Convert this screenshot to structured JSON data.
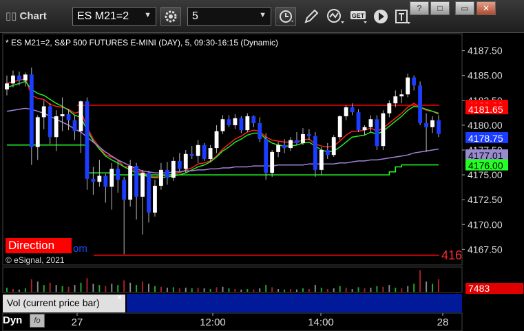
{
  "toolbar": {
    "title": "Chart",
    "symbol_value": "ES M21=2",
    "interval_value": "5",
    "get_label": "GET"
  },
  "window_buttons": [
    "?",
    "□",
    "▭",
    "✕"
  ],
  "chart": {
    "info": "* ES M21=2, S&P 500 FUTURES E-MINI (DAY), 5, 09:30-16:15 (Dynamic)",
    "copyright": "© eSignal, 2021",
    "direction_label": "Direction",
    "direction_tail": "om",
    "right_cut_label": "416",
    "y_ticks": [
      "4187.50",
      "4185.00",
      "4182.50",
      "4180.00",
      "4177.50",
      "4175.00",
      "4172.50",
      "4170.00",
      "4167.50"
    ],
    "x_ticks": [
      "27",
      "12:00",
      "14:00",
      "28"
    ],
    "badges": [
      {
        "text": "4182.00",
        "color": "#ff0000"
      },
      {
        "text": "4181.65",
        "color": "#ff0000"
      },
      {
        "text": "4178.75",
        "color": "#1a3dff"
      },
      {
        "text": "4177.01",
        "color": "#9a8ad0"
      },
      {
        "text": "4176.00",
        "color": "#22ff22"
      }
    ],
    "volume_badge": "7483",
    "volume_label": "Vol (current price bar)",
    "close_glyph": "×",
    "footer_label": "Dyn",
    "footer_icon": "fo"
  },
  "chart_data": {
    "type": "candlestick",
    "y_range": [
      4166.0,
      4189.0
    ],
    "levels": [
      {
        "name": "",
        "value": 4182.0,
        "color": "#ff0000"
      },
      {
        "name": "",
        "value": 4166.9,
        "color": "#ff0000"
      }
    ],
    "candles": [
      [
        4183.6,
        4185.0,
        4183.0,
        4184.2
      ],
      [
        4184.2,
        4185.5,
        4183.8,
        4185.0
      ],
      [
        4185.0,
        4185.4,
        4184.0,
        4184.5
      ],
      [
        4184.5,
        4185.3,
        4183.9,
        4185.1
      ],
      [
        4185.1,
        4185.8,
        4176.0,
        4177.8
      ],
      [
        4177.8,
        4181.0,
        4176.5,
        4180.8
      ],
      [
        4180.8,
        4182.5,
        4179.6,
        4181.9
      ],
      [
        4181.9,
        4182.2,
        4178.1,
        4178.8
      ],
      [
        4178.8,
        4181.5,
        4177.4,
        4180.9
      ],
      [
        4180.9,
        4182.8,
        4179.4,
        4181.1
      ],
      [
        4181.1,
        4181.6,
        4179.5,
        4180.5
      ],
      [
        4180.5,
        4181.0,
        4178.5,
        4179.4
      ],
      [
        4179.4,
        4182.5,
        4177.2,
        4182.4
      ],
      [
        4182.4,
        4182.8,
        4173.5,
        4174.6
      ],
      [
        4174.6,
        4175.8,
        4173.0,
        4174.3
      ],
      [
        4174.3,
        4176.5,
        4173.8,
        4174.9
      ],
      [
        4174.9,
        4175.1,
        4172.2,
        4173.8
      ],
      [
        4173.8,
        4176.2,
        4171.5,
        4175.6
      ],
      [
        4175.6,
        4176.5,
        4173.2,
        4174.5
      ],
      [
        4174.5,
        4174.8,
        4167.0,
        4172.5
      ],
      [
        4172.5,
        4176.5,
        4171.8,
        4175.9
      ],
      [
        4175.9,
        4176.2,
        4170.5,
        4172.8
      ],
      [
        4172.8,
        4175.5,
        4169.0,
        4175.2
      ],
      [
        4175.2,
        4175.4,
        4170.2,
        4171.2
      ],
      [
        4171.2,
        4174.5,
        4170.8,
        4173.9
      ],
      [
        4173.9,
        4176.2,
        4173.5,
        4175.5
      ],
      [
        4175.5,
        4176.3,
        4174.0,
        4174.7
      ],
      [
        4174.7,
        4176.8,
        4174.4,
        4176.4
      ],
      [
        4176.4,
        4177.2,
        4175.3,
        4175.6
      ],
      [
        4175.6,
        4177.5,
        4175.2,
        4177.1
      ],
      [
        4177.1,
        4177.9,
        4176.6,
        4176.9
      ],
      [
        4176.9,
        4178.5,
        4176.2,
        4178.0
      ],
      [
        4178.0,
        4178.2,
        4176.4,
        4176.6
      ],
      [
        4176.6,
        4178.0,
        4176.3,
        4177.7
      ],
      [
        4177.7,
        4180.0,
        4177.2,
        4179.4
      ],
      [
        4179.4,
        4181.0,
        4179.1,
        4180.6
      ],
      [
        4180.6,
        4181.0,
        4179.8,
        4180.0
      ],
      [
        4180.0,
        4181.1,
        4179.6,
        4180.7
      ],
      [
        4180.7,
        4180.9,
        4179.2,
        4179.5
      ],
      [
        4179.5,
        4181.2,
        4179.3,
        4180.9
      ],
      [
        4180.9,
        4181.0,
        4179.8,
        4180.2
      ],
      [
        4180.2,
        4180.8,
        4178.3,
        4178.6
      ],
      [
        4178.6,
        4179.2,
        4174.5,
        4175.2
      ],
      [
        4175.2,
        4177.5,
        4174.8,
        4177.3
      ],
      [
        4177.3,
        4178.3,
        4176.8,
        4178.0
      ],
      [
        4178.0,
        4178.6,
        4177.2,
        4177.7
      ],
      [
        4177.7,
        4178.8,
        4177.4,
        4178.5
      ],
      [
        4178.5,
        4179.3,
        4178.0,
        4178.2
      ],
      [
        4178.2,
        4179.7,
        4178.0,
        4179.1
      ],
      [
        4179.1,
        4179.6,
        4178.5,
        4178.9
      ],
      [
        4178.9,
        4179.3,
        4174.8,
        4175.5
      ],
      [
        4175.5,
        4177.8,
        4175.0,
        4177.5
      ],
      [
        4177.5,
        4178.2,
        4176.6,
        4177.0
      ],
      [
        4177.0,
        4179.0,
        4176.8,
        4178.8
      ],
      [
        4178.8,
        4181.0,
        4178.5,
        4180.9
      ],
      [
        4180.9,
        4182.0,
        4180.5,
        4181.8
      ],
      [
        4181.8,
        4182.2,
        4181.0,
        4181.3
      ],
      [
        4181.3,
        4181.6,
        4179.3,
        4179.5
      ],
      [
        4179.5,
        4180.0,
        4179.0,
        4179.8
      ],
      [
        4179.8,
        4181.0,
        4179.3,
        4180.6
      ],
      [
        4180.6,
        4181.0,
        4177.5,
        4177.9
      ],
      [
        4177.9,
        4181.5,
        4177.5,
        4181.2
      ],
      [
        4181.2,
        4182.5,
        4180.8,
        4182.2
      ],
      [
        4182.2,
        4183.5,
        4181.8,
        4182.9
      ],
      [
        4182.9,
        4183.6,
        4182.2,
        4183.1
      ],
      [
        4183.1,
        4185.2,
        4182.8,
        4184.8
      ],
      [
        4184.8,
        4185.0,
        4183.5,
        4184.0
      ],
      [
        4184.0,
        4184.4,
        4180.0,
        4180.2
      ],
      [
        4180.2,
        4181.2,
        4177.3,
        4179.8
      ],
      [
        4179.8,
        4180.9,
        4179.2,
        4180.5
      ],
      [
        4180.5,
        4181.0,
        4178.8,
        4179.1
      ]
    ],
    "volumes": [
      0.18,
      0.12,
      0.1,
      0.15,
      0.55,
      0.45,
      0.3,
      0.4,
      0.3,
      0.25,
      0.22,
      0.3,
      0.4,
      0.6,
      0.35,
      0.3,
      0.25,
      0.35,
      0.3,
      0.5,
      0.4,
      0.3,
      0.45,
      0.35,
      0.25,
      0.22,
      0.18,
      0.2,
      0.15,
      0.18,
      0.15,
      0.18,
      0.15,
      0.12,
      0.2,
      0.22,
      0.15,
      0.12,
      0.1,
      0.12,
      0.1,
      0.15,
      0.3,
      0.2,
      0.12,
      0.1,
      0.12,
      0.1,
      0.15,
      0.12,
      0.3,
      0.18,
      0.12,
      0.15,
      0.25,
      0.18,
      0.12,
      0.2,
      0.15,
      0.18,
      0.25,
      0.22,
      0.3,
      0.18,
      0.15,
      0.25,
      0.35,
      0.95,
      0.45,
      0.35,
      0.55
    ],
    "series": [
      {
        "name": "",
        "color": "#ff2020",
        "values": [
          4184.2,
          4184.4,
          4184.5,
          4184.7,
          4183.0,
          4182.7,
          4182.6,
          4182.1,
          4181.9,
          4181.8,
          4181.6,
          4181.2,
          4181.4,
          4179.8,
          4178.6,
          4177.8,
          4177.0,
          4176.8,
          4176.5,
          4175.8,
          4175.8,
          4175.3,
          4175.3,
          4174.9,
          4174.8,
          4174.9,
          4174.9,
          4175.1,
          4175.2,
          4175.5,
          4175.7,
          4176.1,
          4176.2,
          4176.4,
          4176.9,
          4177.6,
          4178.1,
          4178.6,
          4178.9,
          4179.3,
          4179.5,
          4179.4,
          4178.8,
          4178.5,
          4178.4,
          4178.3,
          4178.3,
          4178.3,
          4178.5,
          4178.6,
          4178.1,
          4177.9,
          4177.8,
          4177.9,
          4178.4,
          4179.0,
          4179.4,
          4179.4,
          4179.5,
          4179.7,
          4179.4,
          4179.7,
          4180.2,
          4180.7,
          4181.2,
          4181.8,
          4182.2,
          4181.8,
          4181.5,
          4181.4,
          4181.1
        ]
      },
      {
        "name": "",
        "color": "#22ee22",
        "values": [
          4183.8,
          4184.0,
          4184.2,
          4184.4,
          4183.6,
          4183.2,
          4183.0,
          4182.6,
          4182.2,
          4181.9,
          4181.5,
          4181.0,
          4180.8,
          4179.5,
          4178.4,
          4177.6,
          4176.9,
          4176.5,
          4176.2,
          4175.8,
          4175.5,
          4175.2,
          4175.0,
          4174.8,
          4174.7,
          4174.7,
          4174.8,
          4174.9,
          4175.0,
          4175.2,
          4175.5,
          4175.8,
          4176.0,
          4176.3,
          4176.8,
          4177.4,
          4177.8,
          4178.3,
          4178.6,
          4179.0,
          4179.2,
          4179.2,
          4178.6,
          4178.2,
          4178.0,
          4177.9,
          4177.9,
          4178.0,
          4178.2,
          4178.3,
          4177.9,
          4177.5,
          4177.3,
          4177.4,
          4177.8,
          4178.3,
          4178.8,
          4178.9,
          4179.0,
          4179.3,
          4179.1,
          4179.4,
          4179.9,
          4180.4,
          4180.9,
          4181.5,
          4181.9,
          4181.8,
          4181.6,
          4181.4,
          4181.2
        ]
      },
      {
        "name": "",
        "color": "#a084d8",
        "values": [
          4181.4,
          4181.5,
          4181.6,
          4181.7,
          4181.6,
          4181.4,
          4181.2,
          4180.9,
          4180.6,
          4180.3,
          4180.0,
          4179.6,
          4179.3,
          4178.8,
          4178.3,
          4177.8,
          4177.3,
          4176.9,
          4176.5,
          4176.2,
          4175.9,
          4175.6,
          4175.4,
          4175.3,
          4175.2,
          4175.2,
          4175.2,
          4175.3,
          4175.3,
          4175.4,
          4175.4,
          4175.5,
          4175.5,
          4175.6,
          4175.6,
          4175.7,
          4175.7,
          4175.8,
          4175.8,
          4175.8,
          4175.9,
          4175.9,
          4175.9,
          4175.9,
          4176.0,
          4176.0,
          4176.0,
          4176.0,
          4176.0,
          4176.1,
          4176.1,
          4176.1,
          4176.1,
          4176.1,
          4176.2,
          4176.2,
          4176.3,
          4176.4,
          4176.4,
          4176.5,
          4176.5,
          4176.6,
          4176.7,
          4176.8,
          4176.9,
          4177.0,
          4177.2,
          4177.3,
          4177.4,
          4177.5,
          4177.6
        ]
      }
    ],
    "step_line": {
      "name": "",
      "color": "#22ff22",
      "values": [
        4178.0,
        4178.0,
        4178.0,
        4178.0,
        4178.0,
        4178.0,
        4178.0,
        4178.0,
        4178.0,
        4178.0,
        4178.0,
        4178.0,
        4178.0,
        4175.2,
        4175.2,
        4175.2,
        4175.2,
        4175.0,
        4175.0,
        4175.0,
        4175.0,
        4175.0,
        4175.0,
        4175.0,
        4175.0,
        4175.0,
        4175.0,
        4175.0,
        4175.0,
        4175.0,
        4175.0,
        4175.0,
        4175.0,
        4175.0,
        4175.0,
        4175.0,
        4175.0,
        4175.0,
        4175.0,
        4175.0,
        4175.0,
        4175.0,
        4175.0,
        4175.0,
        4175.0,
        4175.0,
        4175.0,
        4175.0,
        4175.0,
        4175.0,
        4175.0,
        4175.0,
        4175.0,
        4175.0,
        4175.0,
        4175.0,
        4175.0,
        4175.0,
        4175.0,
        4175.0,
        4175.0,
        4175.0,
        4175.3,
        4175.8,
        4176.0,
        4176.0,
        4176.0,
        4176.0,
        4176.0,
        4176.0,
        4176.0
      ]
    }
  }
}
